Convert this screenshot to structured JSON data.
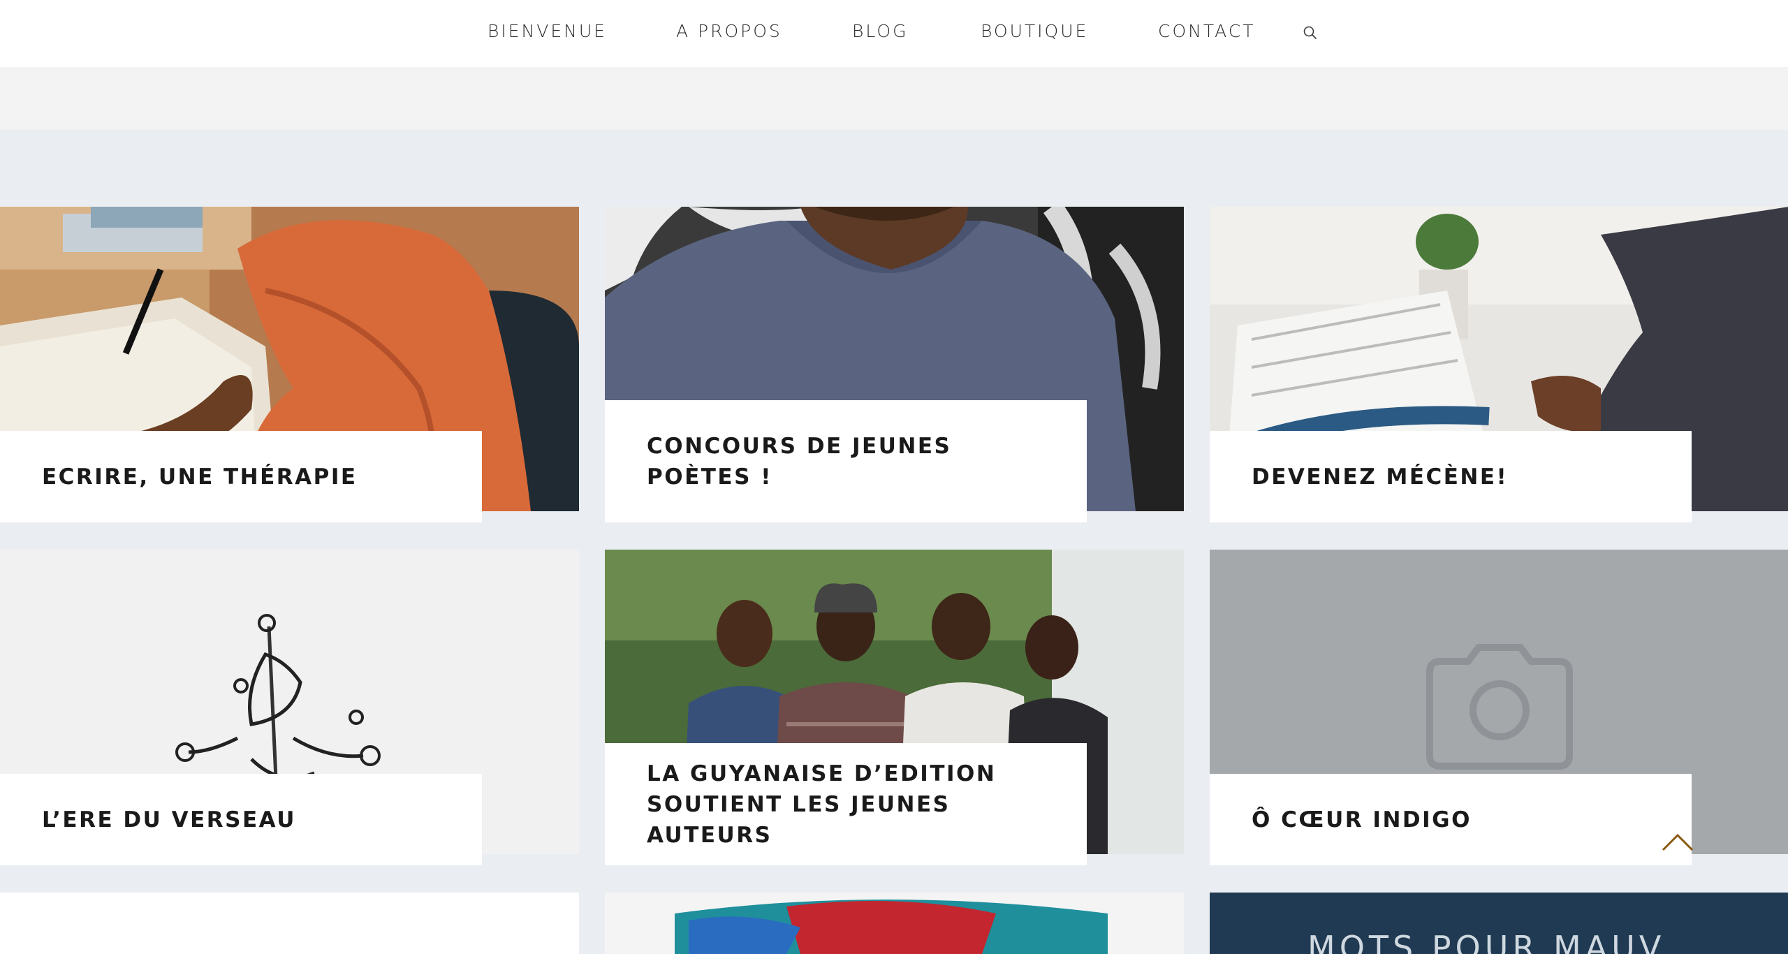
{
  "nav": {
    "items": [
      {
        "label": "BIENVENUE"
      },
      {
        "label": "A PROPOS"
      },
      {
        "label": "BLOG"
      },
      {
        "label": "BOUTIQUE"
      },
      {
        "label": "CONTACT"
      }
    ],
    "search_icon": "search-icon"
  },
  "posts": [
    {
      "title": "ECRIRE, UNE THÉRAPIE",
      "image": "woman-writing-photo"
    },
    {
      "title": "CONCOURS DE JEUNES POÈTES !",
      "image": "young-man-portrait-photo"
    },
    {
      "title": "DEVENEZ MÉCÈNE!",
      "image": "business-newspaper-photo"
    },
    {
      "title": "L’ERE DU VERSEAU",
      "image": "water-splash-photo"
    },
    {
      "title": "LA GUYANAISE D’EDITION SOUTIENT LES JEUNES AUTEURS",
      "image": "group-of-friends-photo"
    },
    {
      "title": "Ô CŒUR INDIGO",
      "image": "camera-placeholder-icon"
    },
    {
      "image": "blank-photo"
    },
    {
      "image": "colorful-hair-photo"
    },
    {
      "image": "book-cover-photo",
      "cover_text": "MOTS POUR MAUV"
    }
  ],
  "scroll_top_icon": "chevron-up-icon",
  "colors": {
    "header_bg": "#ffffff",
    "band_bg": "#f3f3f3",
    "page_bg": "#eaedf1",
    "scroll_top": "#8a5a12"
  }
}
